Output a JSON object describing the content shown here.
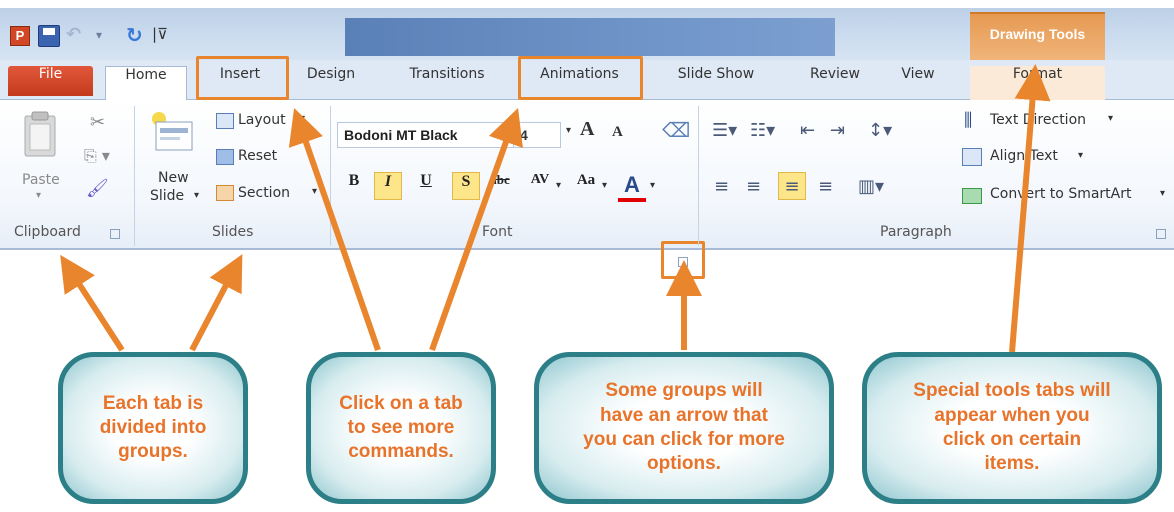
{
  "app": {
    "icon_letter": "P"
  },
  "contextual": {
    "header": "Drawing Tools"
  },
  "tabs": {
    "file": "File",
    "home": "Home",
    "insert": "Insert",
    "design": "Design",
    "transitions": "Transitions",
    "animations": "Animations",
    "slideshow": "Slide Show",
    "review": "Review",
    "view": "View",
    "format": "Format"
  },
  "clipboard": {
    "paste": "Paste",
    "label": "Clipboard"
  },
  "slides": {
    "new_slide_1": "New",
    "new_slide_2": "Slide",
    "layout": "Layout",
    "reset": "Reset",
    "section": "Section",
    "label": "Slides"
  },
  "font": {
    "family": "Bodoni MT Black",
    "size": "4",
    "label": "Font",
    "grow": "A",
    "shrink": "A",
    "bold": "B",
    "italic": "I",
    "underline": "U",
    "shadow": "S",
    "strike": "abc",
    "spacing": "AV",
    "case": "Aa",
    "color": "A"
  },
  "paragraph": {
    "label": "Paragraph",
    "text_direction": "Text Direction",
    "align_text": "Align Text",
    "convert": "Convert to SmartArt"
  },
  "callouts": {
    "groups": [
      "Each tab is",
      "divided into",
      "groups."
    ],
    "tabs": [
      "Click on a tab",
      "to see more",
      "commands."
    ],
    "arrow": [
      "Some groups will",
      "have an arrow that",
      "you can click for more",
      "options."
    ],
    "special": [
      "Special tools tabs will",
      "appear when you",
      "click on certain",
      "items."
    ]
  },
  "colors": {
    "accent_orange": "#e8852d",
    "callout_border": "#2c7f86",
    "callout_text": "#e8732a"
  }
}
